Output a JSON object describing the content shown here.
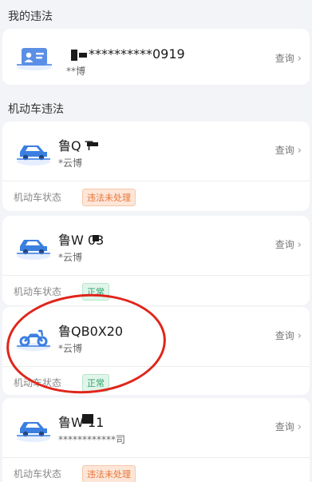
{
  "sections": {
    "license_title": "我的违法",
    "vehicle_title": "机动车违法"
  },
  "license_card": {
    "icon": "id-card-icon",
    "number": "**********0919",
    "owner": "**博",
    "query_label": "查询"
  },
  "vehicles": [
    {
      "icon": "car-icon",
      "plate": "鲁Q T",
      "owner": "*云博",
      "query_label": "查询",
      "status_label": "机动车状态",
      "status": "违法未处理",
      "status_type": "pending"
    },
    {
      "icon": "car-icon",
      "plate": "鲁W 03",
      "owner": "*云博",
      "query_label": "查询",
      "status_label": "机动车状态",
      "status": "正常",
      "status_type": "normal"
    },
    {
      "icon": "motorcycle-icon",
      "plate": "鲁QB0X20",
      "owner": "*云博",
      "query_label": "查询",
      "status_label": "机动车状态",
      "status": "正常",
      "status_type": "normal"
    },
    {
      "icon": "car-icon",
      "plate": "鲁W 11",
      "owner": "************司",
      "query_label": "查询",
      "status_label": "机动车状态",
      "status": "违法未处理",
      "status_type": "pending"
    }
  ],
  "colors": {
    "accent_blue": "#3b7fe0",
    "pending_orange": "#e8763a",
    "normal_green": "#2fa46a",
    "highlight_red": "#e0251b"
  }
}
